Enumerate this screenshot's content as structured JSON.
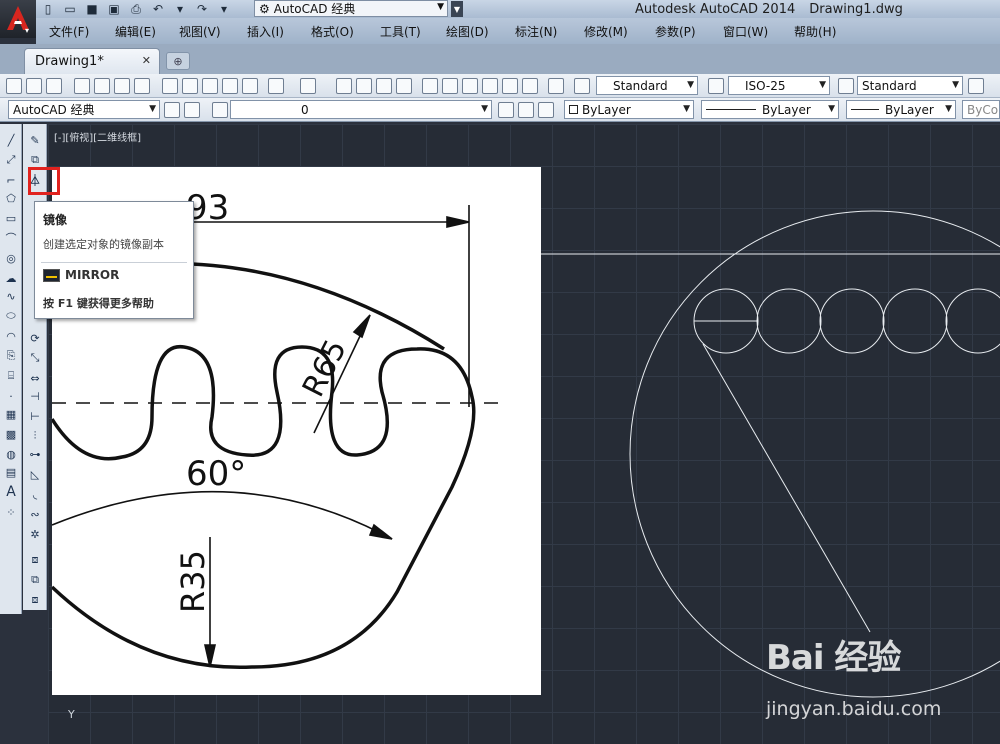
{
  "titlebar": {
    "workspace": "AutoCAD 经典",
    "app_name": "Autodesk AutoCAD 2014",
    "doc_name": "Drawing1.dwg"
  },
  "menu": [
    "文件(F)",
    "编辑(E)",
    "视图(V)",
    "插入(I)",
    "格式(O)",
    "工具(T)",
    "绘图(D)",
    "标注(N)",
    "修改(M)",
    "参数(P)",
    "窗口(W)",
    "帮助(H)"
  ],
  "tabs": {
    "active": "Drawing1*"
  },
  "toolbar1": {
    "text_style": "Standard",
    "dim_style": "ISO-25",
    "table_style": "Standard"
  },
  "toolbar2": {
    "workspace": "AutoCAD 经典",
    "layer": "0",
    "color": "ByLayer",
    "linetype": "ByLayer",
    "lineweight": "ByLayer",
    "plotstyle": "ByColor"
  },
  "viewport": {
    "label": "[-][俯视][二维线框]",
    "ucs_y": "Y"
  },
  "drawing": {
    "dim_93": "93",
    "dim_r65": "R65",
    "dim_60": "60°",
    "dim_r35": "R35"
  },
  "tooltip": {
    "title": "镜像",
    "desc": "创建选定对象的镜像副本",
    "command": "MIRROR",
    "help": "按 F1 键获得更多帮助"
  },
  "watermark": {
    "brand": "Bai 经验",
    "url": "jingyan.baidu.com"
  },
  "colors": {
    "viewport_bg": "#262c36",
    "highlight": "#e1231f"
  }
}
